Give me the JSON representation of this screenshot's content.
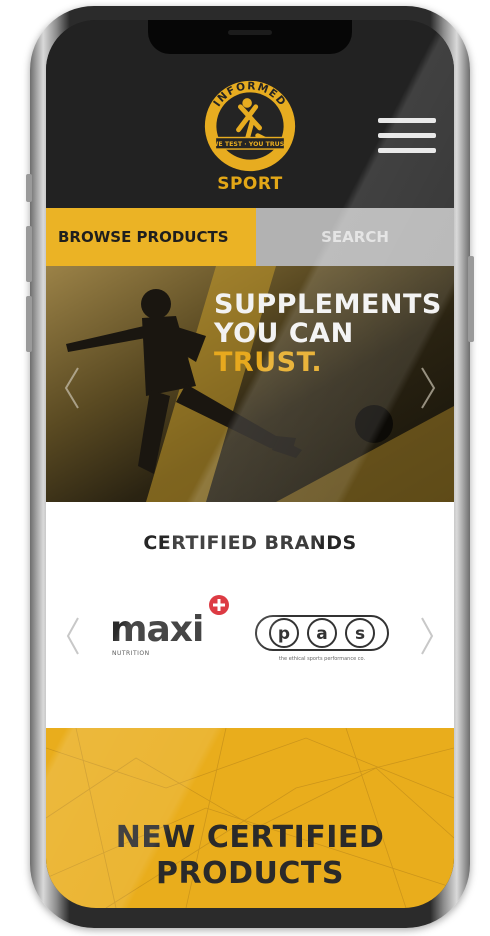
{
  "header": {
    "logo_ring_text": "INFORMED",
    "logo_band_text": "WE TEST · YOU TRUST",
    "brand_name": "SPORT",
    "menu_icon": "hamburger-menu-icon"
  },
  "tabs": {
    "browse_label": "BROWSE PRODUCTS",
    "search_label": "SEARCH"
  },
  "hero": {
    "headline_line1": "SUPPLEMENTS",
    "headline_line2": "YOU CAN",
    "headline_line3": "TRUST.",
    "prev_icon": "chevron-left-icon",
    "next_icon": "chevron-right-icon"
  },
  "brands": {
    "title": "CERTIFIED BRANDS",
    "items": [
      {
        "name": "maxi",
        "subtitle": "NUTRITION"
      },
      {
        "name": "PAS",
        "subtitle": "the ethical sports performance co."
      }
    ],
    "prev_icon": "chevron-left-icon",
    "next_icon": "chevron-right-icon"
  },
  "new_products": {
    "title_line1": "NEW CERTIFIED",
    "title_line2": "PRODUCTS"
  },
  "colors": {
    "accent_gold": "#ebb325",
    "dark_bg": "#222222",
    "tab_gray": "#b2b2b2"
  }
}
